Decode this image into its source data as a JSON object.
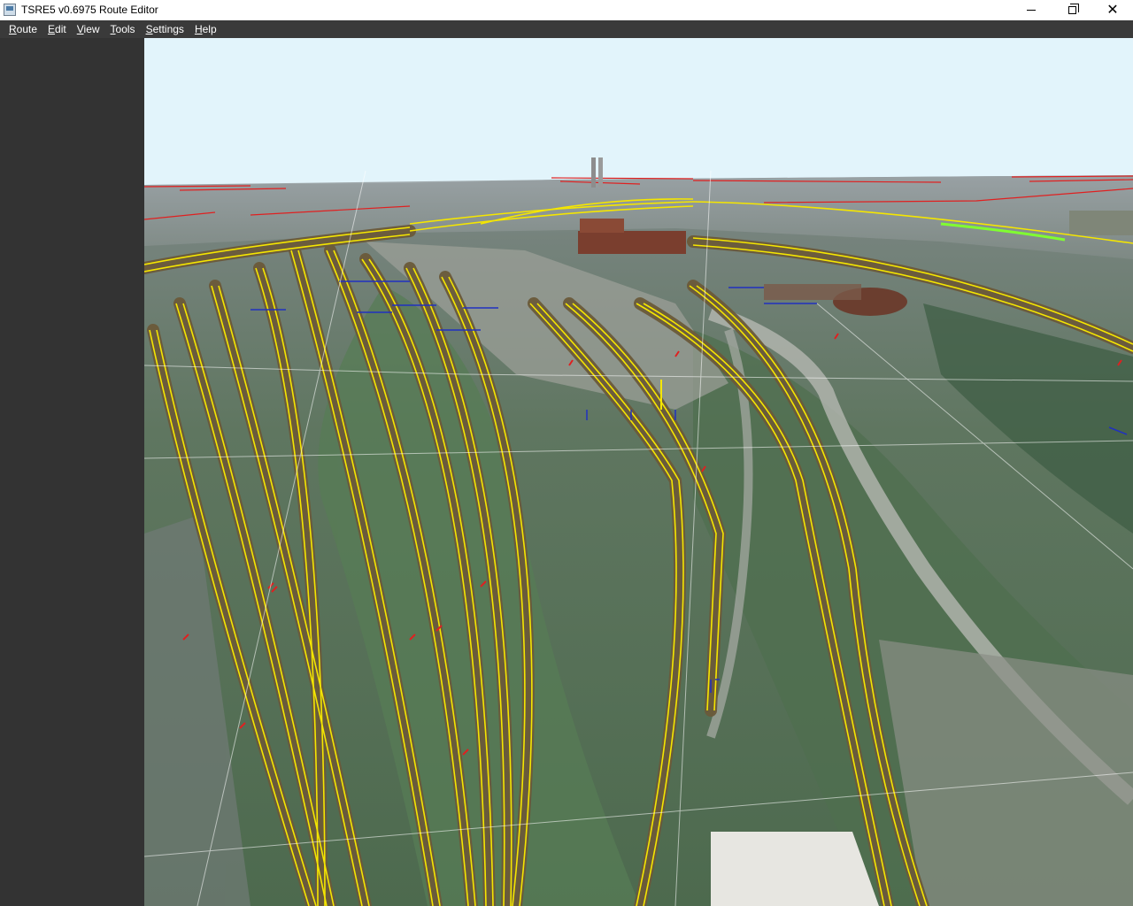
{
  "window": {
    "title": "TSRE5 v0.6975 Route Editor",
    "minimize_icon": "minimize-icon",
    "maximize_icon": "restore-icon",
    "close_icon": "close-icon",
    "close_glyph": "✕"
  },
  "menu": {
    "items": [
      {
        "label": "Route"
      },
      {
        "label": "Edit"
      },
      {
        "label": "View"
      },
      {
        "label": "Tools"
      },
      {
        "label": "Settings"
      },
      {
        "label": "Help"
      }
    ]
  },
  "colors": {
    "menubar": "#3a3a3a",
    "left_panel": "#333333",
    "sky": "#e2f4fb",
    "track_line": "#f5e600",
    "track_bed": "#6b5a3a",
    "marker_red": "#e02020",
    "marker_blue": "#2030c0",
    "terrain_green": "#4a6a50"
  }
}
